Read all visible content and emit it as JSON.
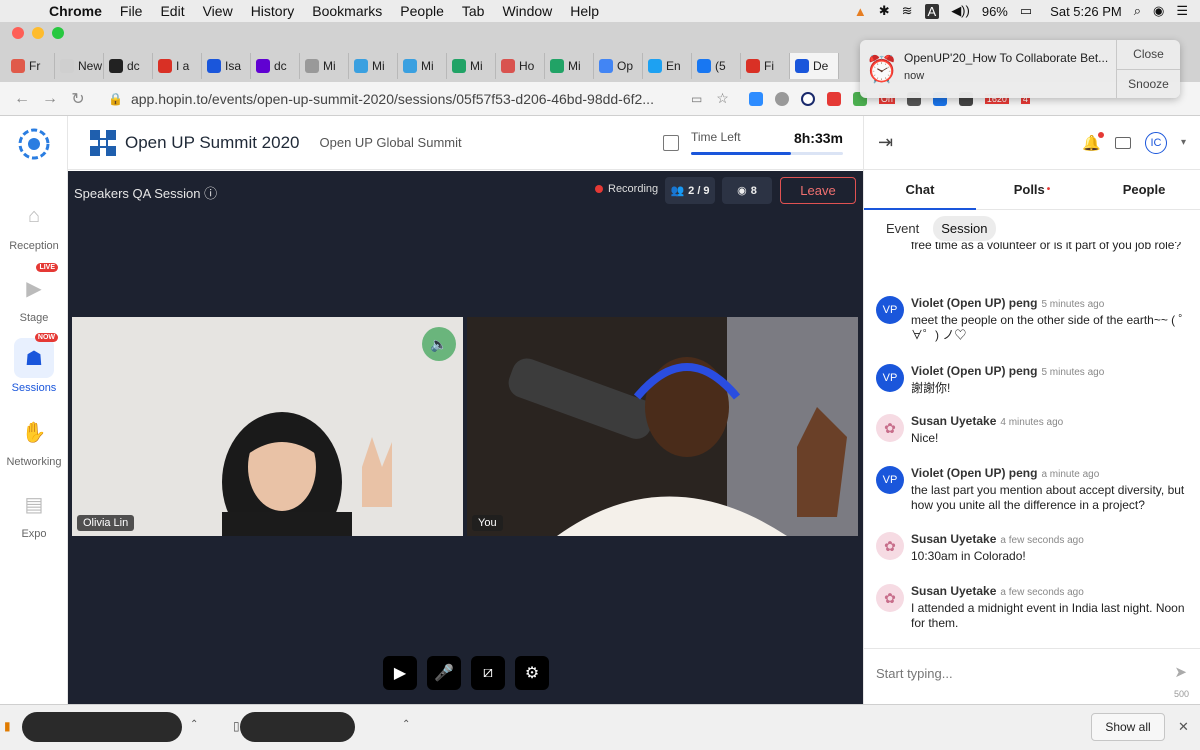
{
  "menubar": {
    "app": "Chrome",
    "items": [
      "File",
      "Edit",
      "View",
      "History",
      "Bookmarks",
      "People",
      "Tab",
      "Window",
      "Help"
    ],
    "battery": "96%",
    "clock": "Sat 5:26 PM"
  },
  "tabs": [
    {
      "label": "Fr",
      "color": "#e05a4a"
    },
    {
      "label": "New T",
      "color": "#cfcfcf"
    },
    {
      "label": "dc",
      "color": "#222222"
    },
    {
      "label": "I a",
      "color": "#d93025"
    },
    {
      "label": "Isa",
      "color": "#1a56db"
    },
    {
      "label": "dc",
      "color": "#6001d2"
    },
    {
      "label": "Mi",
      "color": "#999999"
    },
    {
      "label": "Mi",
      "color": "#3aa0e0"
    },
    {
      "label": "Mi",
      "color": "#3aa0e0"
    },
    {
      "label": "Mi",
      "color": "#21a366"
    },
    {
      "label": "Ho",
      "color": "#d9534f"
    },
    {
      "label": "Mi",
      "color": "#21a366"
    },
    {
      "label": "Op",
      "color": "#4285f4"
    },
    {
      "label": "En",
      "color": "#1da1f2"
    },
    {
      "label": "(5",
      "color": "#1877f2"
    },
    {
      "label": "Fi",
      "color": "#d93025"
    },
    {
      "label": "De",
      "color": "#1a56db"
    }
  ],
  "address": {
    "url": "app.hopin.to/events/open-up-summit-2020/sessions/05f57f53-d206-46bd-98dd-6f2...",
    "ext_on": "On",
    "ext_count": "1620",
    "ext_badge": "4"
  },
  "notification": {
    "title": "OpenUP'20_How To Collaborate Bet...",
    "subtitle": "now",
    "close_label": "Close",
    "snooze_label": "Snooze"
  },
  "leftnav": [
    {
      "label": "Reception",
      "icon": "home-icon",
      "glyph": "⌂",
      "badge": ""
    },
    {
      "label": "Stage",
      "icon": "camera-icon",
      "glyph": "▶",
      "badge": "LIVE"
    },
    {
      "label": "Sessions",
      "icon": "people-icon",
      "glyph": "☗",
      "badge": "NOW"
    },
    {
      "label": "Networking",
      "icon": "handshake-icon",
      "glyph": "✋",
      "badge": ""
    },
    {
      "label": "Expo",
      "icon": "booth-icon",
      "glyph": "▤",
      "badge": ""
    }
  ],
  "event": {
    "name": "Open UP Summit 2020",
    "subtitle": "Open UP Global Summit",
    "time_left_label": "Time Left",
    "time_left_value": "8h:33m",
    "time_progress": 0.66
  },
  "stage": {
    "title": "Speakers QA Session",
    "info_icon": "ⓘ",
    "recording_label": "Recording",
    "participants": "2 / 9",
    "viewers": "8",
    "leave_label": "Leave",
    "tiles": [
      {
        "name": "Olivia Lin"
      },
      {
        "name": "You"
      }
    ]
  },
  "chat": {
    "tabs": [
      {
        "label": "Chat",
        "alert": ""
      },
      {
        "label": "Polls",
        "alert": "•"
      },
      {
        "label": "People",
        "alert": ""
      }
    ],
    "subtabs": [
      "Event",
      "Session"
    ],
    "cutoff_text": "free time as a volunteer or is it part of you job role?",
    "messages": [
      {
        "author": "Violet (Open UP) peng",
        "time": "5 minutes ago",
        "text": "meet the people on the other side of the earth~~ ( ゜∀゜) ノ♡",
        "initials": "VP"
      },
      {
        "author": "Violet (Open UP) peng",
        "time": "5 minutes ago",
        "text": "謝謝你!",
        "initials": "VP"
      },
      {
        "author": "Susan Uyetake",
        "time": "4 minutes ago",
        "text": "Nice!",
        "initials": ""
      },
      {
        "author": "Violet (Open UP) peng",
        "time": "a minute ago",
        "text": "the last part you mention about accept diversity, but how you unite all the difference in a project?",
        "initials": "VP"
      },
      {
        "author": "Susan Uyetake",
        "time": "a few seconds ago",
        "text": "10:30am in Colorado!",
        "initials": ""
      },
      {
        "author": "Susan Uyetake",
        "time": "a few seconds ago",
        "text": "I attended a midnight event in India last night. Noon for them.",
        "initials": ""
      }
    ],
    "composer_placeholder": "Start typing...",
    "char_count": "500",
    "user_initials": "IC"
  },
  "shelf": {
    "show_all_label": "Show all"
  }
}
